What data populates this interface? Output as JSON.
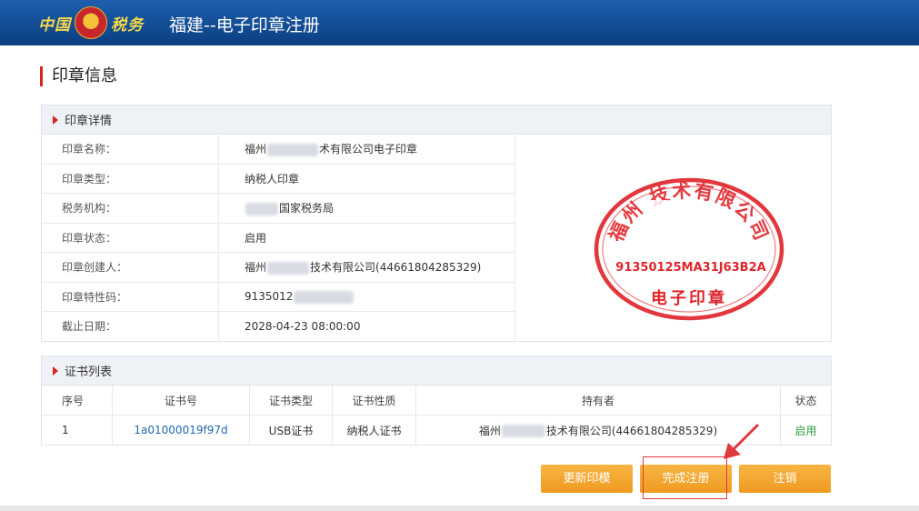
{
  "header": {
    "logo_text_left": "中国",
    "logo_text_right": "税务",
    "title": "福建--电子印章注册"
  },
  "page": {
    "title": "印章信息"
  },
  "seal_detail": {
    "section_title": "印章详情",
    "rows": [
      {
        "label": "印章名称：",
        "value_prefix": "福州",
        "value_suffix": "术有限公司电子印章",
        "style": "link"
      },
      {
        "label": "印章类型：",
        "value_prefix": "纳税人印章",
        "value_suffix": "",
        "style": ""
      },
      {
        "label": "税务机构：",
        "value_prefix": "",
        "value_suffix": "国家税务局",
        "style": ""
      },
      {
        "label": "印章状态：",
        "value_prefix": "启用",
        "value_suffix": "",
        "style": "green"
      },
      {
        "label": "印章创建人：",
        "value_prefix": "福州",
        "value_suffix": "技术有限公司(44661804285329)",
        "style": ""
      },
      {
        "label": "印章特性码：",
        "value_prefix": "9135012",
        "value_suffix": "",
        "style": ""
      },
      {
        "label": "截止日期：",
        "value_prefix": "2028-04-23 08:00:00",
        "value_suffix": "",
        "style": ""
      }
    ],
    "seal_image": {
      "top_text": "福州 技术有限公司",
      "code": "91350125MA31J63B2A",
      "bottom_text": "电子印章",
      "color": "#e0262d"
    }
  },
  "certificates": {
    "section_title": "证书列表",
    "columns": [
      "序号",
      "证书号",
      "证书类型",
      "证书性质",
      "持有者",
      "状态"
    ],
    "rows": [
      {
        "index": "1",
        "cert_no": "1a01000019f97d",
        "cert_type": "USB证书",
        "cert_nature": "纳税人证书",
        "holder_prefix": "福州",
        "holder_suffix": "技术有限公司(44661804285329)",
        "status": "启用"
      }
    ]
  },
  "buttons": {
    "update": "更新印模",
    "complete": "完成注册",
    "cancel": "注销"
  },
  "colors": {
    "header": "#0b3f80",
    "accent": "#d9221c",
    "button": "#f2a22e",
    "link": "#2266b0",
    "status_green": "#2e9b3c"
  }
}
